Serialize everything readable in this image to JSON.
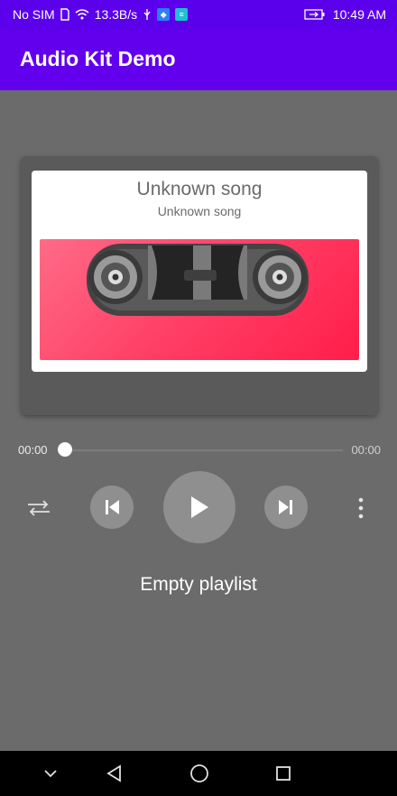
{
  "status_bar": {
    "carrier": "No SIM",
    "speed": "13.3B/s",
    "time": "10:49 AM",
    "icons": [
      "sim-icon",
      "wifi-icon",
      "usb-icon",
      "app-badge-icon",
      "app-badge-icon",
      "battery-icon"
    ]
  },
  "app_bar": {
    "title": "Audio Kit Demo"
  },
  "player": {
    "song_title": "Unknown song",
    "song_artist": "Unknown song",
    "time_current": "00:00",
    "time_total": "00:00",
    "progress": 0
  },
  "controls": [
    "shuffle-icon",
    "previous-icon",
    "play-icon",
    "next-icon",
    "more-vertical-icon"
  ],
  "playlist": {
    "status": "Empty playlist"
  },
  "nav_bar": {
    "icons": [
      "chevron-down-icon",
      "back-triangle-icon",
      "home-circle-icon",
      "recents-square-icon"
    ]
  },
  "colors": {
    "accent": "#6200EE",
    "status_bar": "#5B00EA",
    "background": "#6B6B6B",
    "cover_gradient_start": "#FF6B86",
    "cover_gradient_end": "#FF1E4A"
  }
}
